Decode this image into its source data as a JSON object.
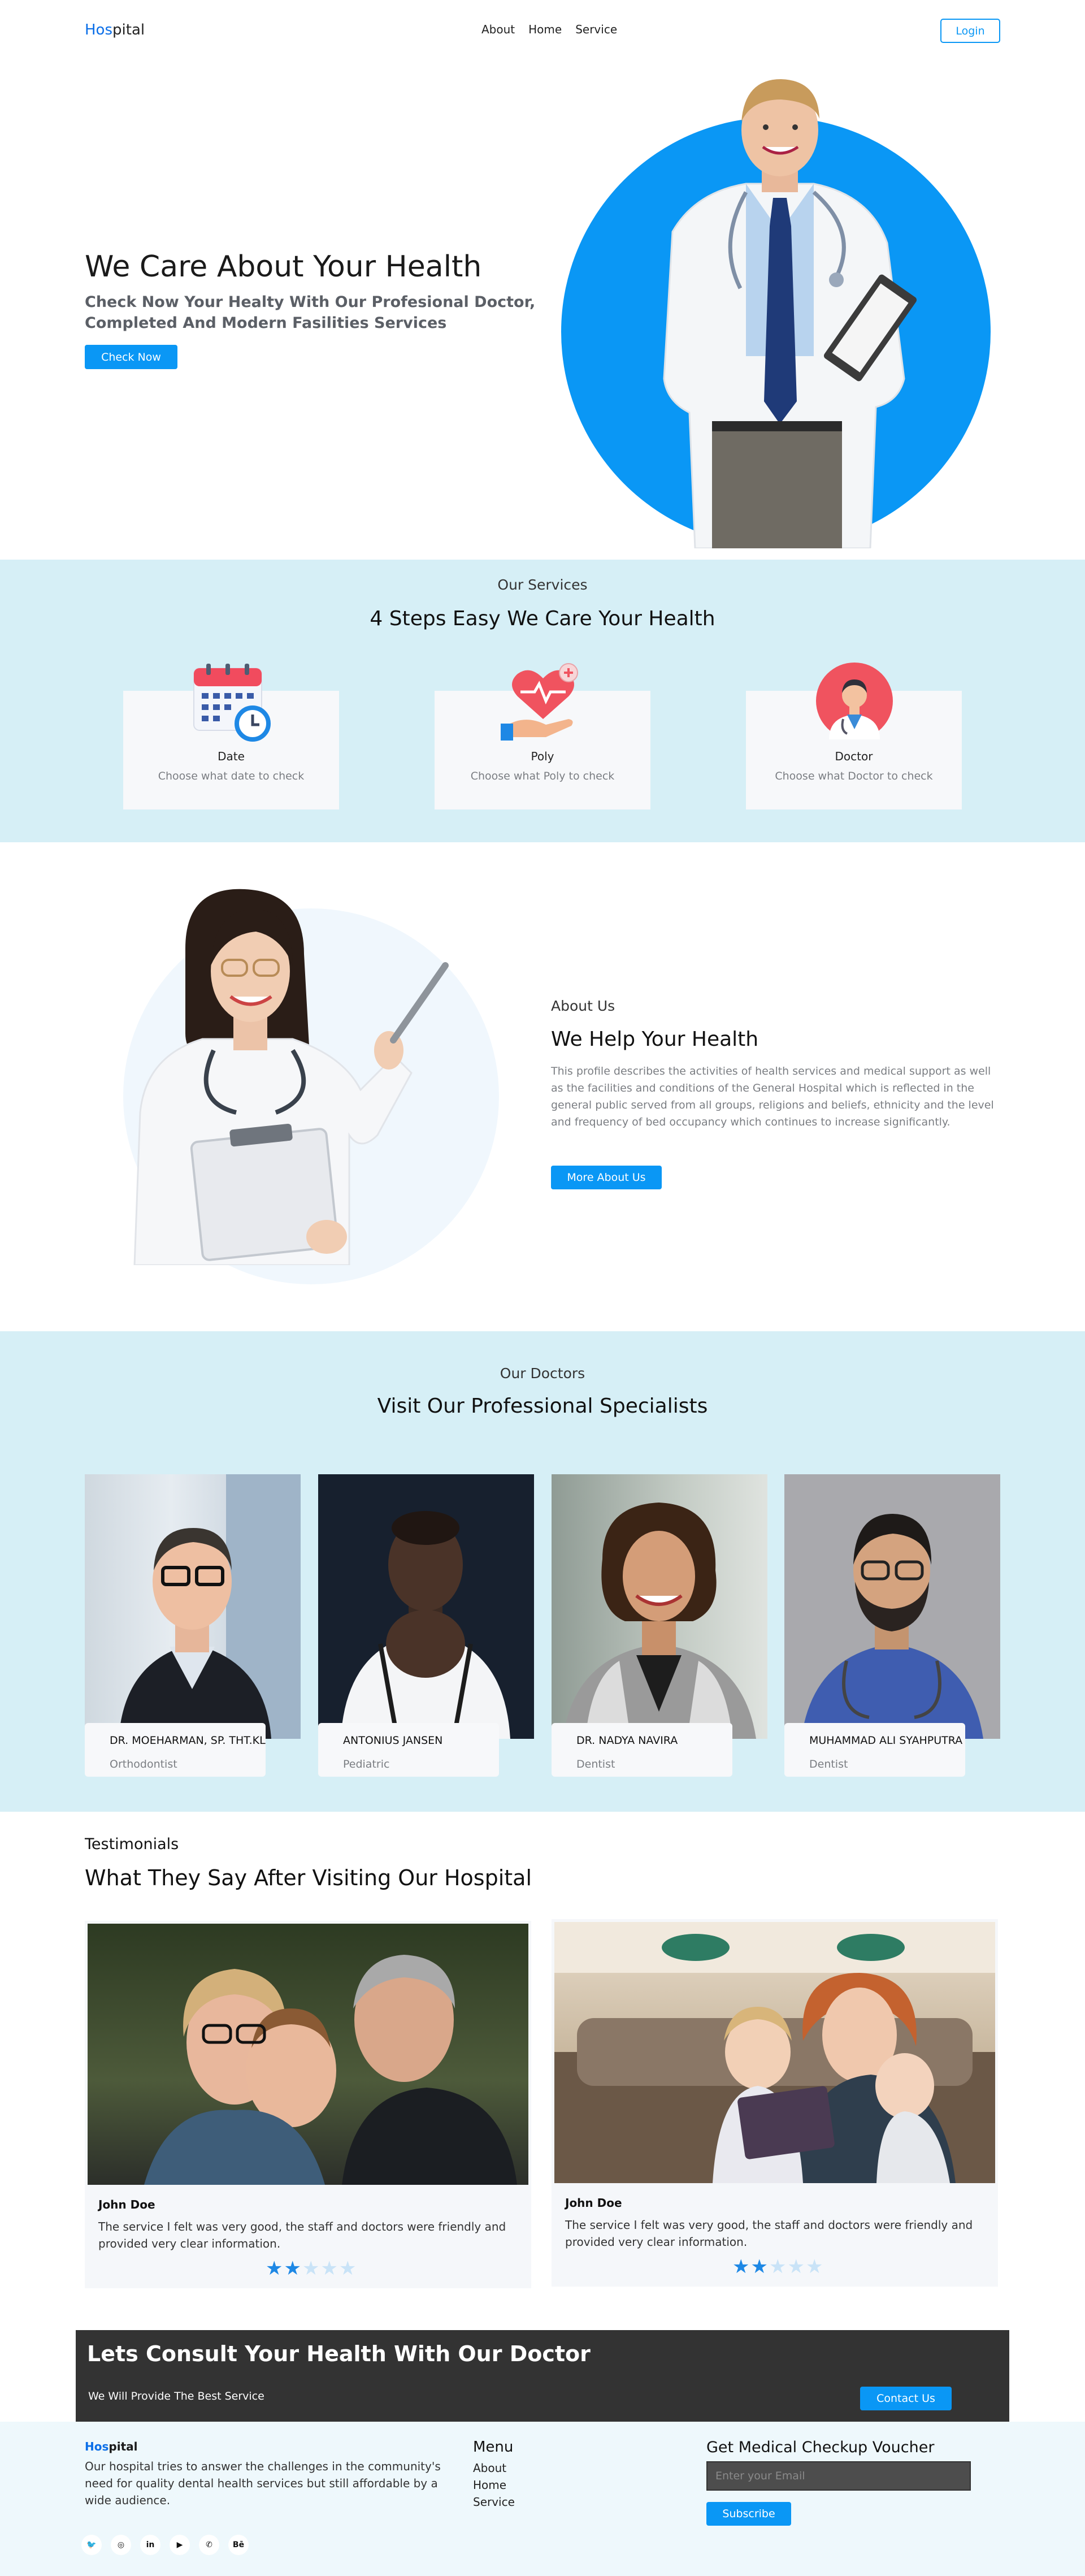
{
  "nav": {
    "logo_a": "Hos",
    "logo_b": "pital",
    "links": [
      "About",
      "Home",
      "Service"
    ],
    "login": "Login"
  },
  "hero": {
    "title": "We Care About Your Health",
    "subtitle": "Check Now Your Healty With Our Profesional Doctor, Completed And Modern Fasilities Services",
    "button": "Check Now"
  },
  "services": {
    "eyebrow": "Our Services",
    "title": "4 Steps Easy We Care Your Health",
    "items": [
      {
        "name": "Date",
        "desc": "Choose what date to check",
        "icon": "calendar-clock-icon"
      },
      {
        "name": "Poly",
        "desc": "Choose what Poly to check",
        "icon": "heart-hand-icon"
      },
      {
        "name": "Doctor",
        "desc": "Choose what Doctor to check",
        "icon": "doctor-avatar-icon"
      }
    ]
  },
  "about": {
    "eyebrow": "About Us",
    "title": "We Help Your Health",
    "text": "This profile describes the activities of health services and medical support as well as the facilities and conditions of the General Hospital which is reflected in the general public served from all groups, religions and beliefs, ethnicity and the level and frequency of bed occupancy which continues to increase significantly.",
    "button": "More About Us"
  },
  "doctors": {
    "eyebrow": "Our Doctors",
    "title": "Visit Our Professional Specialists",
    "items": [
      {
        "name": "DR. MOEHARMAN, SP. THT.KL",
        "role": "Orthodontist"
      },
      {
        "name": "ANTONIUS JANSEN",
        "role": "Pediatric"
      },
      {
        "name": "DR. NADYA NAVIRA",
        "role": "Dentist"
      },
      {
        "name": "MUHAMMAD ALI SYAHPUTRA",
        "role": "Dentist"
      }
    ]
  },
  "testimonials": {
    "eyebrow": "Testimonials",
    "title": "What They Say After Visiting Our Hospital",
    "items": [
      {
        "name": "John Doe",
        "text": "The service I felt was very good, the staff and doctors were friendly and provided very clear information.",
        "rating": 2
      },
      {
        "name": "John Doe",
        "text": "The service I felt was very good, the staff and doctors were friendly and provided very clear information.",
        "rating": 2
      }
    ],
    "max_rating": 5
  },
  "cta": {
    "title": "Lets Consult Your Health With Our Doctor",
    "subtitle": "We Will Provide The Best Service",
    "button": "Contact Us"
  },
  "footer": {
    "logo_a": "Hos",
    "logo_b": "pital",
    "desc": "Our hospital tries to answer the challenges in the community's need for quality dental health services but still affordable by a wide audience.",
    "menu_title": "Menu",
    "menu": [
      "About",
      "Home",
      "Service"
    ],
    "voucher_title": "Get Medical Checkup Voucher",
    "email_placeholder": "Enter your Email",
    "subscribe": "Subscribe",
    "socials": [
      {
        "icon": "twitter-icon",
        "glyph": "🐦"
      },
      {
        "icon": "instagram-icon",
        "glyph": "◎"
      },
      {
        "icon": "linkedin-icon",
        "glyph": "in"
      },
      {
        "icon": "youtube-icon",
        "glyph": "▶"
      },
      {
        "icon": "whatsapp-icon",
        "glyph": "✆"
      },
      {
        "icon": "behance-icon",
        "glyph": "Bē"
      }
    ]
  },
  "colors": {
    "primary": "#0a97f5",
    "brand": "#0a6ee8",
    "section_bg": "#d6eff6",
    "dark": "#333333",
    "star_on": "#1e88e5",
    "star_off": "#c9e3f7"
  }
}
